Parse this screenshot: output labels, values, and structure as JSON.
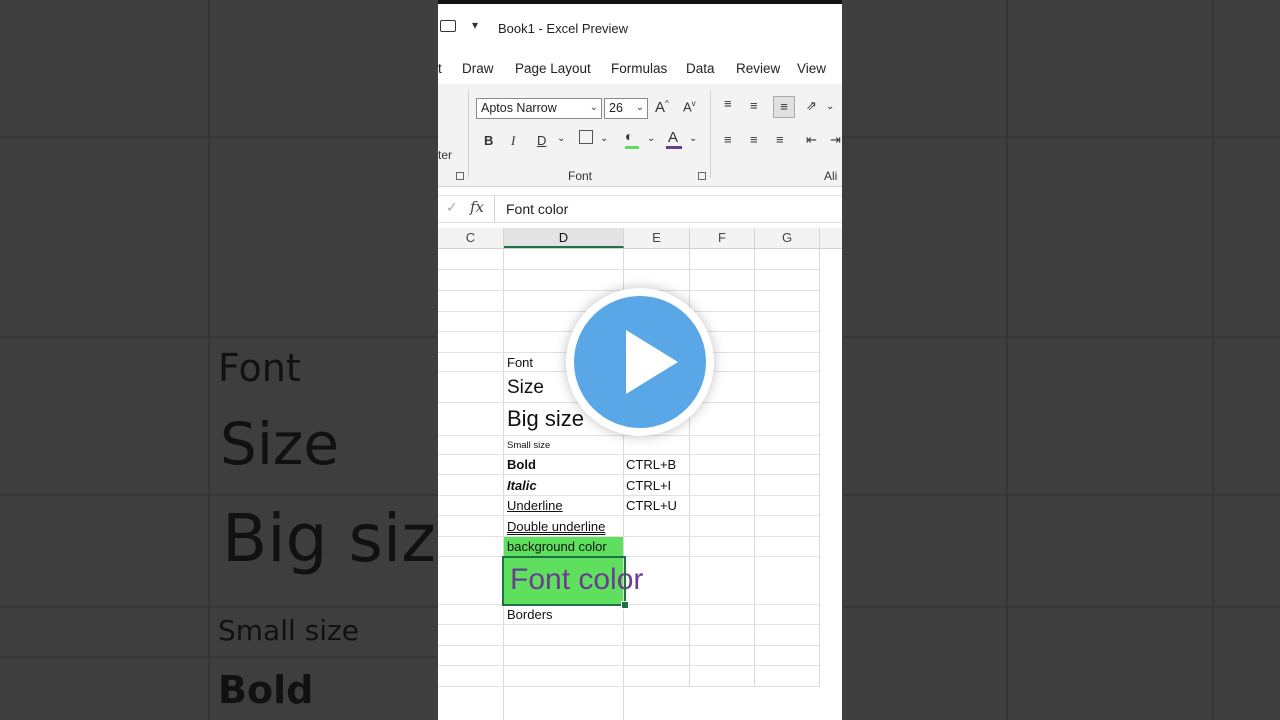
{
  "window": {
    "title": "Book1  -  Excel Preview"
  },
  "tabs": [
    {
      "label": "t"
    },
    {
      "label": "Draw"
    },
    {
      "label": "Page Layout"
    },
    {
      "label": "Formulas"
    },
    {
      "label": "Data"
    },
    {
      "label": "Review"
    },
    {
      "label": "View"
    }
  ],
  "ribbon": {
    "font_name": "Aptos Narrow",
    "font_size": "26",
    "grow_font": "A",
    "shrink_font": "A",
    "bold": "B",
    "italic": "I",
    "underline": "D",
    "font_color_glyph": "A",
    "left_fragment": "ter",
    "font_group_label": "Font",
    "align_group_label": "Ali"
  },
  "formula_bar": {
    "fx": "fx",
    "content": "Font color"
  },
  "columns": [
    "C",
    "D",
    "E",
    "F",
    "G"
  ],
  "cells": {
    "d_font": "Font",
    "d_size": "Size",
    "d_big": "Big size",
    "d_small": "Small size",
    "d_bold": "Bold",
    "e_bold": "CTRL+B",
    "d_italic": "Italic",
    "e_italic": "CTRL+I",
    "d_underline": "Underline",
    "e_underline": "CTRL+U",
    "d_double": "Double underline",
    "d_bg": "background color",
    "d_fontcolor": "Font color",
    "d_borders": "Borders"
  },
  "colors": {
    "selection_green": "#1e7145",
    "fill_green": "#5ee05e",
    "font_color_purple": "#6b3d8f",
    "play_blue": "#59a7e6"
  },
  "ghost": {
    "font": "Font",
    "size": "Size",
    "big": "Big size",
    "small": "Small size",
    "bold": "Bold"
  }
}
